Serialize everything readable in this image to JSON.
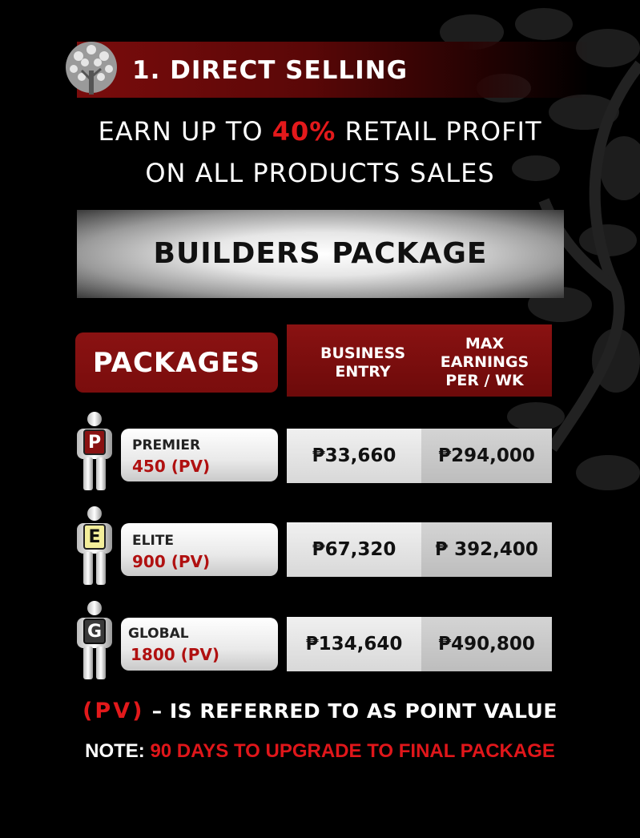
{
  "header": {
    "title": "1. DIRECT SELLING",
    "logo_icon": "tree-logo-icon"
  },
  "earn": {
    "line1_prefix": "EARN UP TO ",
    "line1_highlight": "40%",
    "line1_suffix": " RETAIL PROFIT",
    "line2": "ON ALL PRODUCTS SALES"
  },
  "builders": {
    "title": "BUILDERS PACKAGE"
  },
  "table": {
    "packages_label": "PACKAGES",
    "col1_line1": "BUSINESS",
    "col1_line2": "ENTRY",
    "col2_line1": "MAX",
    "col2_line2": "EARNINGS",
    "col2_line3": "PER / WK",
    "rows": [
      {
        "letter": "P",
        "badge_color": "#8a1212",
        "letter_color": "#ffffff",
        "name": "PREMIER",
        "pv": "450 (PV)",
        "entry": "₱33,660",
        "max": "₱294,000"
      },
      {
        "letter": "E",
        "badge_color": "#f3ee9a",
        "letter_color": "#111111",
        "name": "ELITE",
        "pv": "900 (PV)",
        "entry": "₱67,320",
        "max": "₱ 392,400"
      },
      {
        "letter": "G",
        "badge_color": "#3a3a3a",
        "letter_color": "#ffffff",
        "name": "GLOBAL",
        "pv": "1800 (PV)",
        "entry": "₱134,640",
        "max": "₱490,800"
      }
    ]
  },
  "footer": {
    "pv_label": "(PV)",
    "pv_text": " – IS REFERRED TO AS POINT VALUE",
    "note_label": "NOTE: ",
    "note_text": "90 DAYS TO UPGRADE TO FINAL PACKAGE"
  },
  "colors": {
    "accent_red": "#e3191b",
    "banner_red": "#8a1212"
  }
}
